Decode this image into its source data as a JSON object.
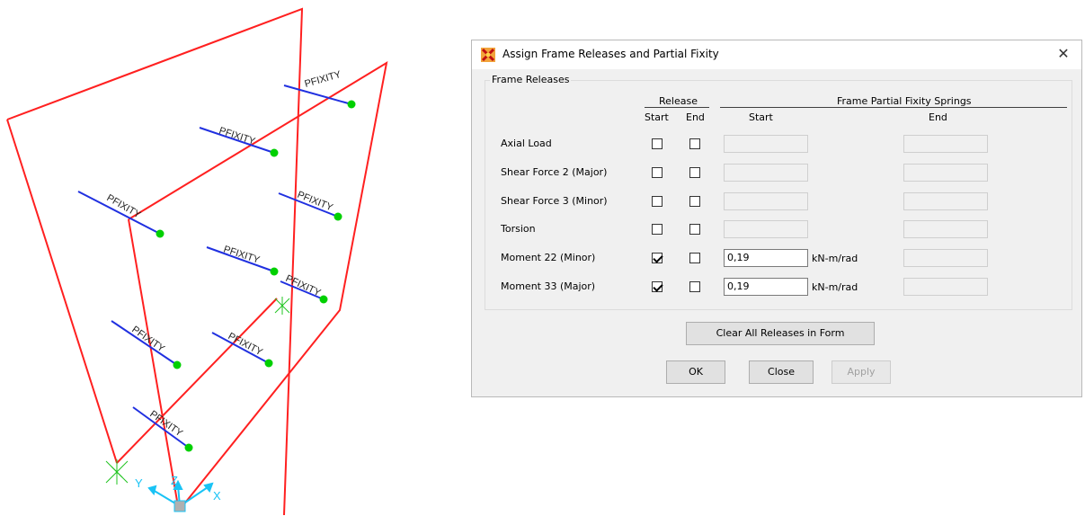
{
  "viewport": {
    "member_label": "PFIXITY",
    "axis_x": "X",
    "axis_y": "Y",
    "axis_z": "Z",
    "colors": {
      "frame": "#ff2020",
      "member": "#2030e0",
      "node": "#00d000",
      "axis": "#19c3f5",
      "support": "#22c422"
    }
  },
  "dialog": {
    "title": "Assign Frame Releases and Partial Fixity",
    "close_glyph": "✕",
    "group_label": "Frame Releases",
    "headers": {
      "release": "Release",
      "springs": "Frame Partial Fixity Springs",
      "start": "Start",
      "end": "End",
      "spring_start": "Start",
      "spring_end": "End"
    },
    "rows": [
      {
        "label": "Axial Load",
        "start_checked": false,
        "end_checked": false,
        "spring_start": "",
        "units": ""
      },
      {
        "label": "Shear Force 2 (Major)",
        "start_checked": false,
        "end_checked": false,
        "spring_start": "",
        "units": ""
      },
      {
        "label": "Shear Force 3 (Minor)",
        "start_checked": false,
        "end_checked": false,
        "spring_start": "",
        "units": ""
      },
      {
        "label": "Torsion",
        "start_checked": false,
        "end_checked": false,
        "spring_start": "",
        "units": ""
      },
      {
        "label": "Moment 22 (Minor)",
        "start_checked": true,
        "end_checked": false,
        "spring_start": "0,19",
        "units": "kN-m/rad"
      },
      {
        "label": "Moment 33 (Major)",
        "start_checked": true,
        "end_checked": false,
        "spring_start": "0,19",
        "units": "kN-m/rad"
      }
    ],
    "buttons": {
      "clear": "Clear All Releases in Form",
      "ok": "OK",
      "close": "Close",
      "apply": "Apply"
    }
  }
}
